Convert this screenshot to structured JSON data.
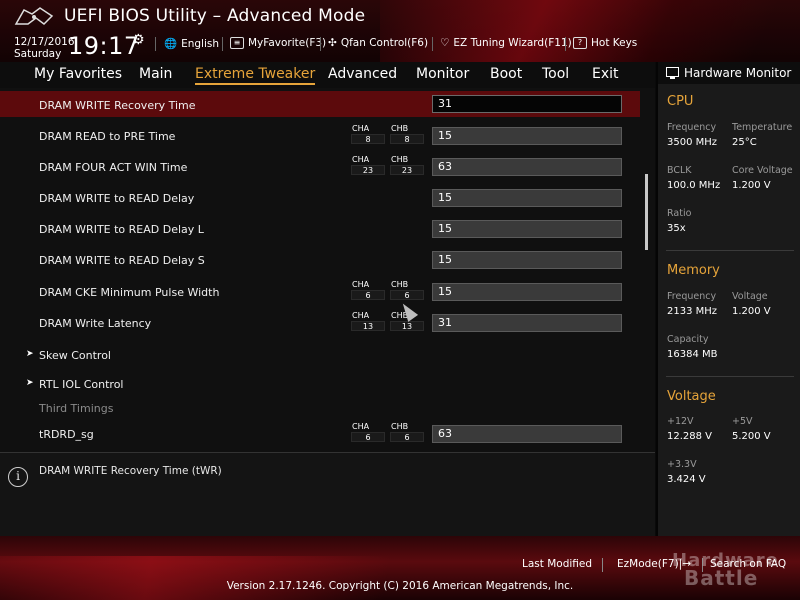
{
  "header": {
    "title": "UEFI BIOS Utility – Advanced Mode",
    "date": "12/17/2016",
    "day": "Saturday",
    "time": "19:17",
    "buttons": [
      {
        "icon": "globe-icon",
        "label": "English"
      },
      {
        "icon": "favorite-icon",
        "label": "MyFavorite(F3)"
      },
      {
        "icon": "fan-icon",
        "label": "Qfan Control(F6)"
      },
      {
        "icon": "bulb-icon",
        "label": "EZ Tuning Wizard(F11)"
      },
      {
        "icon": "help-icon",
        "label": "Hot Keys"
      }
    ]
  },
  "nav": {
    "tabs": [
      "My Favorites",
      "Main",
      "Extreme Tweaker",
      "Advanced",
      "Monitor",
      "Boot",
      "Tool",
      "Exit"
    ],
    "active": "Extreme Tweaker"
  },
  "rows": [
    {
      "label": "DRAM WRITE Recovery Time",
      "value": "31",
      "selected": true
    },
    {
      "label": "DRAM READ to PRE Time",
      "cha": "8",
      "chb": "8",
      "value": "15"
    },
    {
      "label": "DRAM FOUR ACT WIN Time",
      "cha": "23",
      "chb": "23",
      "value": "63"
    },
    {
      "label": "DRAM WRITE to READ Delay",
      "value": "15"
    },
    {
      "label": "DRAM WRITE to READ Delay L",
      "value": "15"
    },
    {
      "label": "DRAM WRITE to READ Delay S",
      "value": "15"
    },
    {
      "label": "DRAM CKE Minimum Pulse Width",
      "cha": "6",
      "chb": "6",
      "value": "15"
    },
    {
      "label": "DRAM Write Latency",
      "cha": "13",
      "chb": "13",
      "value": "31"
    },
    {
      "label": "Skew Control",
      "submenu": true
    },
    {
      "label": "RTL IOL Control",
      "submenu": true
    },
    {
      "label": "Third Timings",
      "heading": true
    },
    {
      "label": "tRDRD_sg",
      "cha": "6",
      "chb": "6",
      "value": "63"
    }
  ],
  "channel_labels": {
    "a": "CHA",
    "b": "CHB"
  },
  "help": {
    "text": "DRAM WRITE Recovery Time (tWR)"
  },
  "hardware_monitor": {
    "title": "Hardware Monitor",
    "cpu": {
      "heading": "CPU",
      "frequency_label": "Frequency",
      "frequency": "3500 MHz",
      "temperature_label": "Temperature",
      "temperature": "25°C",
      "bclk_label": "BCLK",
      "bclk": "100.0 MHz",
      "core_voltage_label": "Core Voltage",
      "core_voltage": "1.200 V",
      "ratio_label": "Ratio",
      "ratio": "35x"
    },
    "memory": {
      "heading": "Memory",
      "frequency_label": "Frequency",
      "frequency": "2133 MHz",
      "voltage_label": "Voltage",
      "voltage": "1.200 V",
      "capacity_label": "Capacity",
      "capacity": "16384 MB"
    },
    "voltage": {
      "heading": "Voltage",
      "v12_label": "+12V",
      "v12": "12.288 V",
      "v5_label": "+5V",
      "v5": "5.200 V",
      "v33_label": "+3.3V",
      "v33": "3.424 V"
    }
  },
  "footer": {
    "last_modified": "Last Modified",
    "ezmode": "EzMode(F7)|→",
    "search": "Search on FAQ",
    "version": "Version 2.17.1246. Copyright (C) 2016 American Megatrends, Inc.",
    "watermark_line1": "Hardware",
    "watermark_line2": "Battle"
  },
  "colors": {
    "accent": "#e6a43a",
    "selected_row": "#5c0a0c",
    "brand_red": "#a00a14"
  }
}
